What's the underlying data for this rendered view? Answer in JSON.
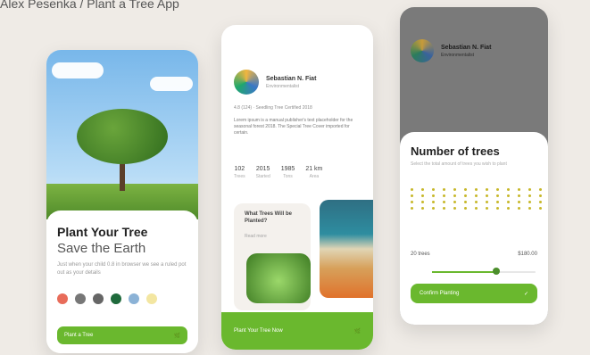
{
  "caption": "Alex Pesenka / Plant a Tree App",
  "screen1": {
    "title": "Plant Your Tree",
    "subtitle": "Save the Earth",
    "description": "Just when your child 0.8 in browser we see a ruled pot out as your details",
    "cta_label": "Plant a Tree"
  },
  "screen2": {
    "name": "Sebastian N. Fiat",
    "role": "Environmentalist",
    "rating_text": "4.8 (124) · Seedling Tree Certified 2018",
    "about": "Lorem ipsum is a manual publisher's text placeholder for the seasonal forest 2018. The Special Tree Cover imported for certain.",
    "stats": [
      {
        "value": "102",
        "label": "Trees"
      },
      {
        "value": "2015",
        "label": "Started"
      },
      {
        "value": "1985",
        "label": "Tons"
      },
      {
        "value": "21 km",
        "label": "Area"
      }
    ],
    "question": "What Trees Will be Planted?",
    "question_sub": "Read more",
    "cta_label": "Plant Your Tree Now"
  },
  "screen3": {
    "name": "Sebastian N. Fiat",
    "role": "Environmentalist",
    "sheet_title": "Number of trees",
    "sheet_subtitle": "Select the total amount of trees you wish to plant",
    "trees_label": "20 trees",
    "price_label": "$180.00",
    "slider_value": 0.62,
    "cta_label": "Confirm Planting"
  },
  "accent": "#6ab82e"
}
